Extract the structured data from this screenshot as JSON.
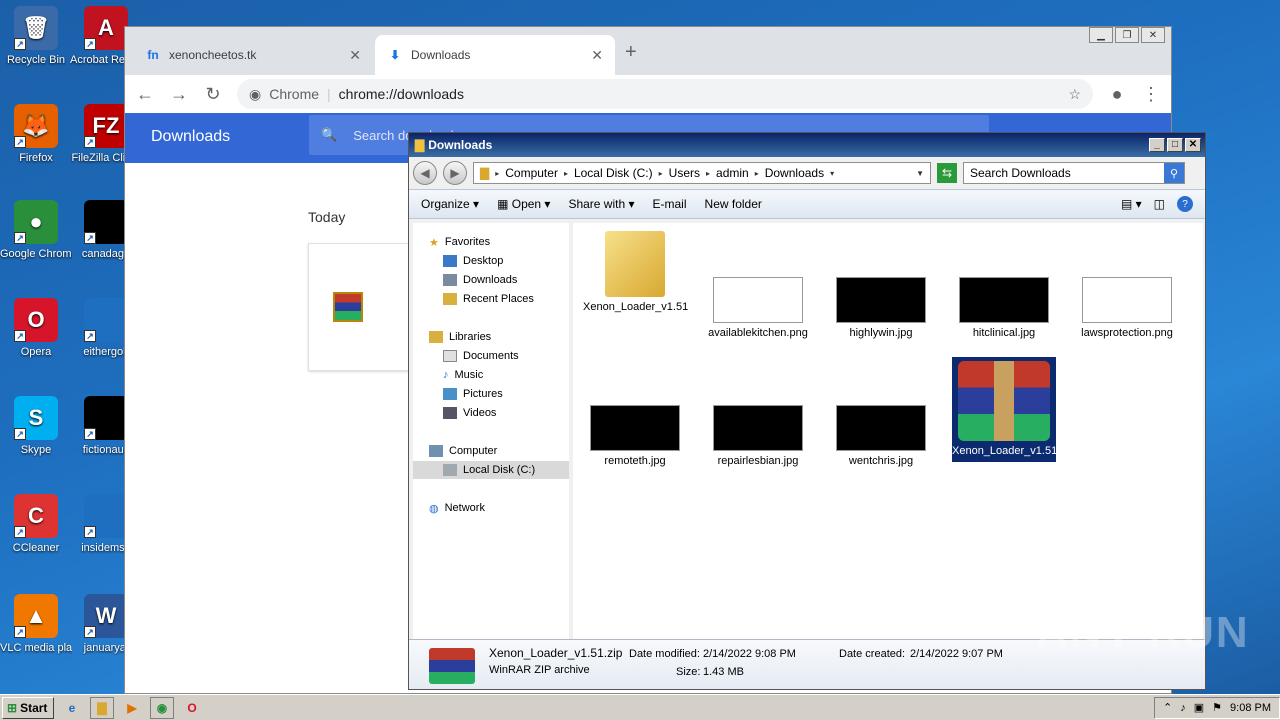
{
  "desktop": {
    "icons": [
      {
        "label": "Recycle Bin",
        "glyph": "🗑",
        "color": "#3a6aa8"
      },
      {
        "label": "Acrobat Reader DC",
        "glyph": "A",
        "color": "#c1121f"
      },
      {
        "label": "Firefox",
        "glyph": "🦊",
        "color": "#e66000"
      },
      {
        "label": "FileZilla Client",
        "glyph": "FZ",
        "color": "#bf0000"
      },
      {
        "label": "Google Chrome",
        "glyph": "●",
        "color": "#2a8f3a"
      },
      {
        "label": "canadage",
        "glyph": "",
        "color": "#000000"
      },
      {
        "label": "Opera",
        "glyph": "O",
        "color": "#d7152a"
      },
      {
        "label": "eithergolf",
        "glyph": "",
        "color": "#1e6fc0"
      },
      {
        "label": "Skype",
        "glyph": "S",
        "color": "#00aff0"
      },
      {
        "label": "fictionaus",
        "glyph": "",
        "color": "#000000"
      },
      {
        "label": "CCleaner",
        "glyph": "C",
        "color": "#d33"
      },
      {
        "label": "insidemsn",
        "glyph": "",
        "color": "#1e6fc0"
      },
      {
        "label": "VLC media player",
        "glyph": "▲",
        "color": "#f07800"
      },
      {
        "label": "januaryal",
        "glyph": "W",
        "color": "#2b579a"
      }
    ]
  },
  "chrome": {
    "tabs": [
      {
        "label": "xenoncheetos.tk",
        "favicon": "fn"
      },
      {
        "label": "Downloads",
        "favicon": "download-icon"
      }
    ],
    "omnibox_site": "Chrome",
    "omnibox_url": "chrome://downloads",
    "page_title": "Downloads",
    "search_placeholder": "Search downloads",
    "section_today": "Today"
  },
  "explorer": {
    "title": "Downloads",
    "breadcrumbs": [
      "Computer",
      "Local Disk (C:)",
      "Users",
      "admin",
      "Downloads"
    ],
    "search_placeholder": "Search Downloads",
    "commands": [
      "Organize",
      "Open",
      "Share with",
      "E-mail",
      "New folder"
    ],
    "nav": {
      "favorites": "Favorites",
      "favorites_items": [
        "Desktop",
        "Downloads",
        "Recent Places"
      ],
      "libraries": "Libraries",
      "libraries_items": [
        "Documents",
        "Music",
        "Pictures",
        "Videos"
      ],
      "computer": "Computer",
      "computer_items": [
        "Local Disk (C:)"
      ],
      "network": "Network"
    },
    "files": [
      {
        "name": "Xenon_Loader_v1.51",
        "kind": "folder"
      },
      {
        "name": "availablekitchen.png",
        "kind": "light"
      },
      {
        "name": "highlywin.jpg",
        "kind": "dark"
      },
      {
        "name": "hitclinical.jpg",
        "kind": "dark"
      },
      {
        "name": "lawsprotection.png",
        "kind": "light"
      },
      {
        "name": "remoteth.jpg",
        "kind": "dark"
      },
      {
        "name": "repairlesbian.jpg",
        "kind": "dark"
      },
      {
        "name": "wentchris.jpg",
        "kind": "dark"
      },
      {
        "name": "Xenon_Loader_v1.51.zip",
        "kind": "winrar",
        "selected": true
      }
    ],
    "details": {
      "name": "Xenon_Loader_v1.51.zip",
      "type": "WinRAR ZIP archive",
      "modified_label": "Date modified:",
      "modified": "2/14/2022 9:08 PM",
      "size_label": "Size:",
      "size": "1.43 MB",
      "created_label": "Date created:",
      "created": "2/14/2022 9:07 PM"
    }
  },
  "taskbar": {
    "start": "Start",
    "clock": "9:08 PM"
  },
  "watermark": "ANY RUN"
}
